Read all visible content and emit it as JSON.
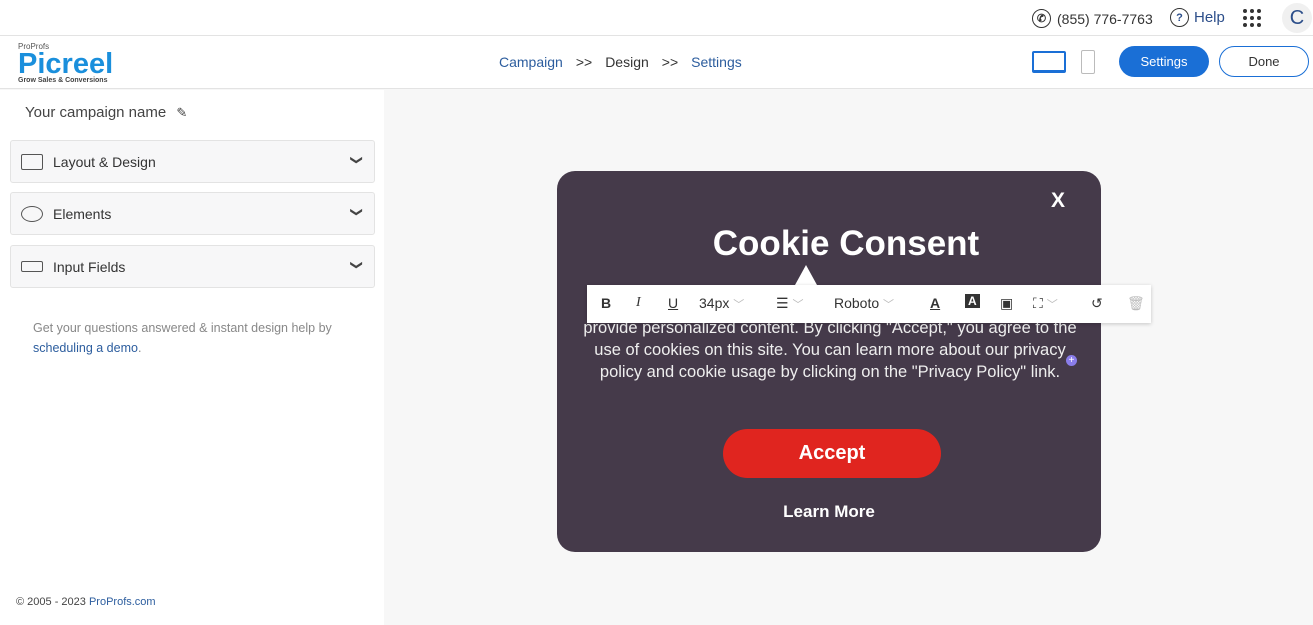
{
  "topbar": {
    "phone": "(855) 776-7763",
    "help": "Help",
    "avatar": "C"
  },
  "logo": {
    "brand": "ProProfs",
    "name": "Picreel",
    "tagline": "Grow Sales & Conversions"
  },
  "breadcrumb": {
    "items": [
      "Campaign",
      "Design",
      "Settings"
    ],
    "separator": ">>"
  },
  "header": {
    "settings": "Settings",
    "done": "Done"
  },
  "sidebar": {
    "campaign_name": "Your campaign name",
    "sections": [
      "Layout & Design",
      "Elements",
      "Input Fields"
    ],
    "help_text": "Get your questions answered & instant design help by",
    "help_link": "scheduling a demo",
    "help_end": ".",
    "copyright": "© 2005 - 2023",
    "copyright_link": "ProProfs.com"
  },
  "popup": {
    "close": "X",
    "title": "Cookie Consent",
    "body": "provide personalized content. By clicking \"Accept,\" you agree to the use of cookies on this site. You can learn more about our privacy policy and cookie usage by clicking on the \"Privacy Policy\" link.",
    "accept": "Accept",
    "learn_more": "Learn More",
    "bg": "#453a4a",
    "accent": "#e0251f"
  },
  "toolbar": {
    "bold": "B",
    "italic": "I",
    "underline": "U",
    "font_size": "34px",
    "font": "Roboto"
  }
}
